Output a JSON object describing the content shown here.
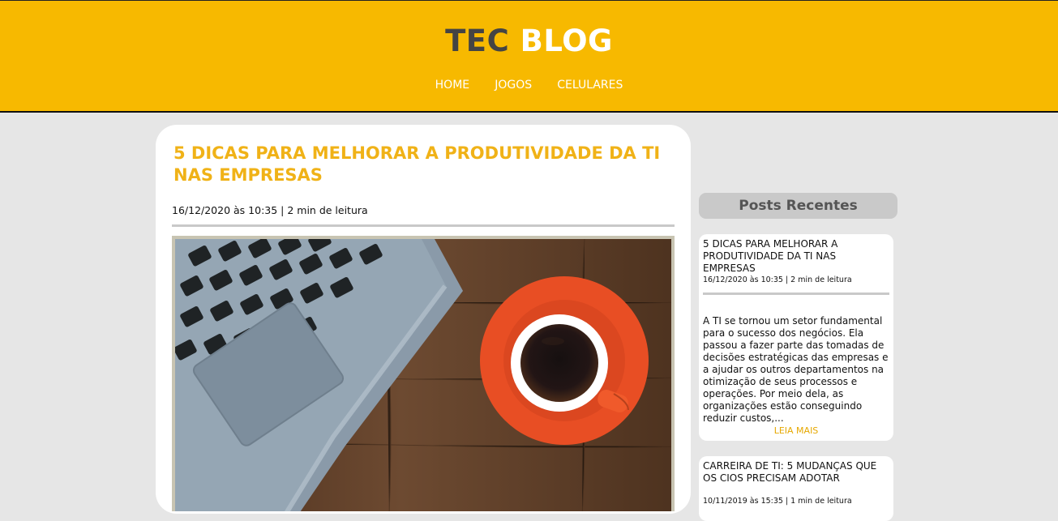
{
  "header": {
    "logo_part1": "TEC",
    "logo_part2": "BLOG",
    "nav": [
      "HOME",
      "JOGOS",
      "CELULARES"
    ]
  },
  "article": {
    "title": "5 DICAS PARA MELHORAR A PRODUTIVIDADE DA TI NAS EMPRESAS",
    "meta": "16/12/2020 às 10:35 | 2 min de leitura",
    "image": "laptop-and-coffee-on-wooden-desk"
  },
  "sidebar": {
    "title": "Posts Recentes",
    "posts": [
      {
        "title": "5 DICAS PARA MELHORAR A PRODUTIVIDADE DA TI NAS EMPRESAS",
        "meta": "16/12/2020 às 10:35 | 2 min de leitura",
        "excerpt": "A TI se tornou um setor fundamental para o sucesso dos negócios. Ela passou a fazer parte das tomadas de decisões estratégicas das empresas e a ajudar os outros departamentos na otimização de seus processos e operações. Por meio dela, as organizações estão conseguindo reduzir custos,...",
        "more": "LEIA MAIS"
      },
      {
        "title": "CARREIRA DE TI: 5 MUDANÇAS QUE OS CIOS PRECISAM ADOTAR",
        "meta": "10/11/2019 às 15:35 | 1 min de leitura"
      }
    ]
  },
  "colors": {
    "header": "#f7b900",
    "accent": "#f0b217",
    "background": "#e6e6e6"
  }
}
